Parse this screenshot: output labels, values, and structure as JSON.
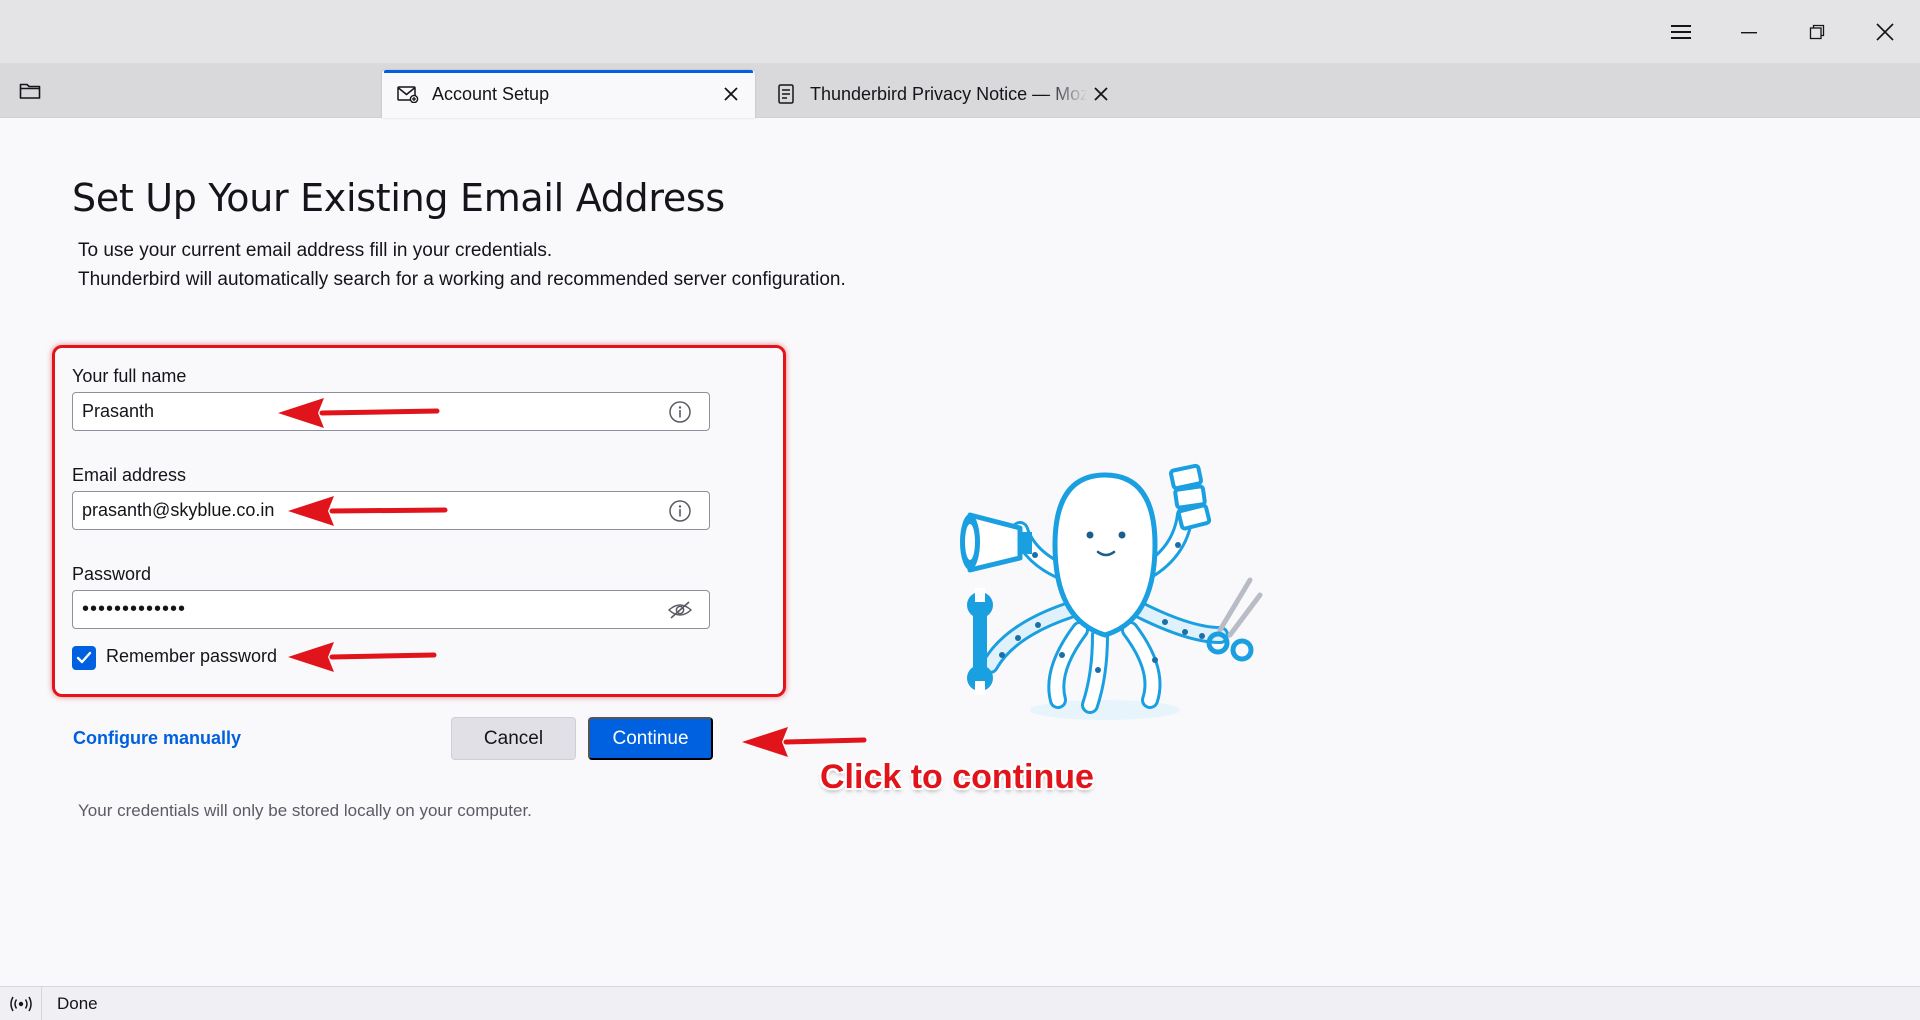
{
  "window": {
    "menu_icon": "hamburger-menu-icon",
    "minimize_icon": "minimize-icon",
    "restore_icon": "restore-icon",
    "close_icon": "close-icon"
  },
  "tabs": [
    {
      "label": "Account Setup",
      "icon": "mail-setup-icon",
      "active": true
    },
    {
      "label": "Thunderbird Privacy Notice — Mozilla",
      "icon": "document-icon",
      "active": false
    }
  ],
  "page": {
    "title": "Set Up Your Existing Email Address",
    "intro_line1": "To use your current email address fill in your credentials.",
    "intro_line2": "Thunderbird will automatically search for a working and recommended server configuration."
  },
  "form": {
    "name_label": "Your full name",
    "name_value": "Prasanth",
    "email_label": "Email address",
    "email_value": "prasanth@skyblue.co.in",
    "password_label": "Password",
    "password_value": "•••••••••••••",
    "remember_label": "Remember password",
    "remember_checked": true
  },
  "actions": {
    "configure_manually": "Configure manually",
    "cancel": "Cancel",
    "continue": "Continue"
  },
  "footnote": "Your credentials will only be stored locally on your computer.",
  "annotation": {
    "click_text": "Click to continue",
    "color": "#e0141a"
  },
  "status": {
    "text": "Done",
    "icon": "broadcast-icon"
  },
  "colors": {
    "accent": "#0060df",
    "mascot_blue": "#1a9fe0"
  }
}
